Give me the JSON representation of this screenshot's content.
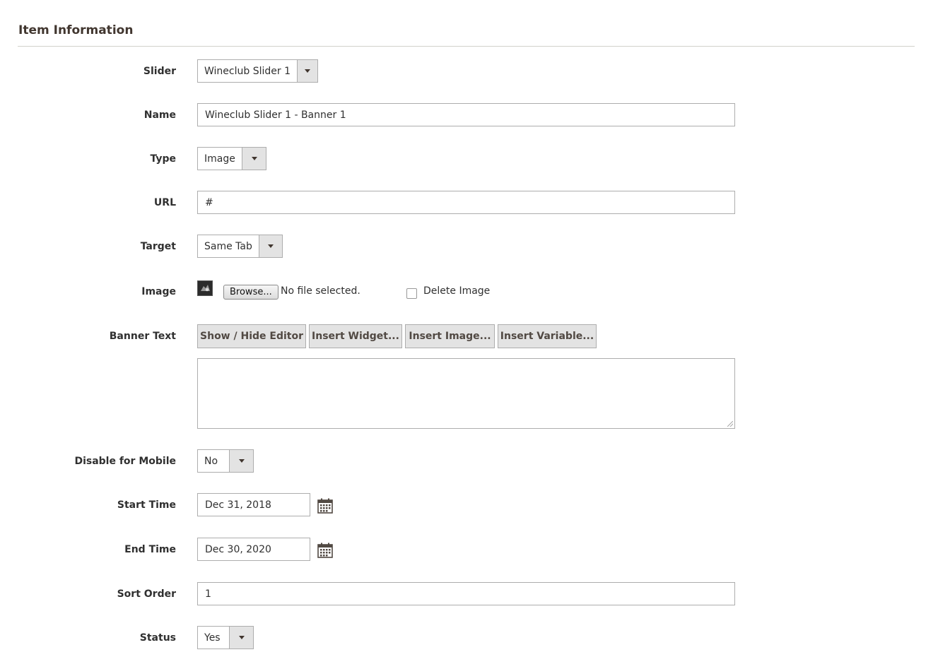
{
  "section": {
    "title": "Item Information"
  },
  "fields": {
    "slider": {
      "label": "Slider",
      "value": "Wineclub Slider 1"
    },
    "name": {
      "label": "Name",
      "value": "Wineclub Slider 1 - Banner 1"
    },
    "type": {
      "label": "Type",
      "value": "Image"
    },
    "url": {
      "label": "URL",
      "value": "#"
    },
    "target": {
      "label": "Target",
      "value": "Same Tab"
    },
    "image": {
      "label": "Image",
      "browse_label": "Browse...",
      "file_status": "No file selected.",
      "delete_label": "Delete Image",
      "delete_checked": false
    },
    "banner_text": {
      "label": "Banner Text",
      "buttons": {
        "toggle_editor": "Show / Hide Editor",
        "insert_widget": "Insert Widget...",
        "insert_image": "Insert Image...",
        "insert_variable": "Insert Variable..."
      },
      "value": ""
    },
    "disable_mobile": {
      "label": "Disable for Mobile",
      "value": "No"
    },
    "start_time": {
      "label": "Start Time",
      "value": "Dec 31, 2018"
    },
    "end_time": {
      "label": "End Time",
      "value": "Dec 30, 2020"
    },
    "sort_order": {
      "label": "Sort Order",
      "value": "1"
    },
    "status": {
      "label": "Status",
      "value": "Yes"
    }
  },
  "icons": {
    "select_arrow": "chevron-down-icon",
    "calendar": "calendar-icon"
  }
}
